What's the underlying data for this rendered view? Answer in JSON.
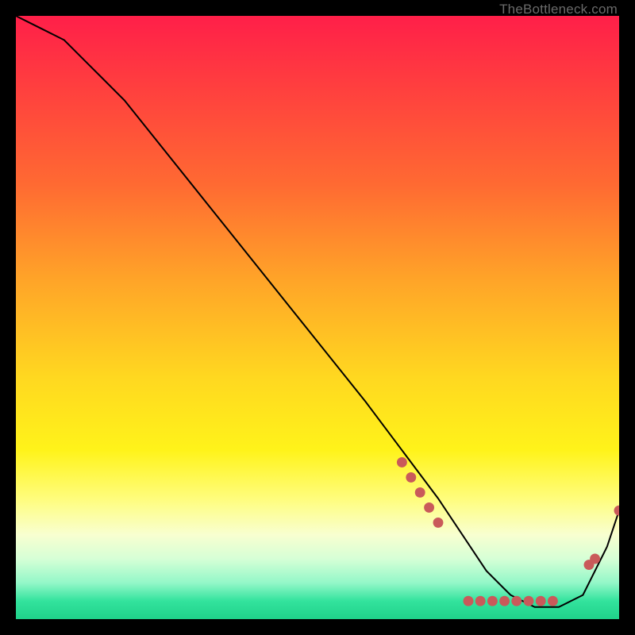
{
  "watermark": "TheBottleneck.com",
  "chart_data": {
    "type": "line",
    "title": "",
    "xlabel": "",
    "ylabel": "",
    "xlim": [
      0,
      100
    ],
    "ylim": [
      0,
      100
    ],
    "grid": false,
    "legend": false,
    "background_gradient": {
      "top_color": "#ff1f49",
      "bottom_color": "#1fd18a",
      "description": "vertical red→orange→yellow→green gradient"
    },
    "series": [
      {
        "name": "bottleneck-curve",
        "color": "#000000",
        "x": [
          0,
          4,
          8,
          12,
          18,
          26,
          34,
          42,
          50,
          58,
          64,
          70,
          74,
          78,
          82,
          86,
          90,
          94,
          98,
          100
        ],
        "y": [
          100,
          98,
          96,
          92,
          86,
          76,
          66,
          56,
          46,
          36,
          28,
          20,
          14,
          8,
          4,
          2,
          2,
          4,
          12,
          18
        ]
      }
    ],
    "markers": [
      {
        "name": "cluster-descending",
        "color": "#c95a5a",
        "shape": "circle",
        "x": [
          64,
          65.5,
          67,
          68.5,
          70
        ],
        "y": [
          26,
          23.5,
          21,
          18.5,
          16
        ]
      },
      {
        "name": "cluster-bottom",
        "color": "#c95a5a",
        "shape": "circle",
        "x": [
          75,
          77,
          79,
          81,
          83,
          85,
          87,
          89
        ],
        "y": [
          3,
          3,
          3,
          3,
          3,
          3,
          3,
          3
        ]
      },
      {
        "name": "cluster-rising",
        "color": "#c95a5a",
        "shape": "circle",
        "x": [
          95,
          96,
          100
        ],
        "y": [
          9,
          10,
          18
        ]
      }
    ],
    "annotations": []
  }
}
